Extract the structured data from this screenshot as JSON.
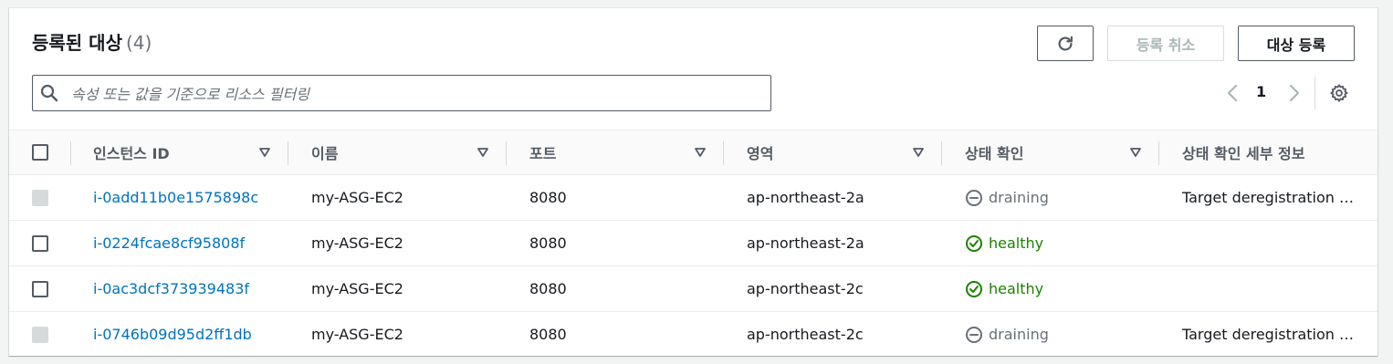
{
  "header": {
    "title": "등록된 대상",
    "count": "(4)",
    "refresh_icon": "refresh-icon",
    "deregister_label": "등록 취소",
    "register_label": "대상 등록"
  },
  "search": {
    "placeholder": "속성 또는 값을 기준으로 리소스 필터링",
    "icon": "search-icon"
  },
  "pagination": {
    "current_page": "1",
    "prev_icon": "chevron-left-icon",
    "next_icon": "chevron-right-icon",
    "settings_icon": "gear-icon"
  },
  "table": {
    "columns": [
      "인스턴스 ID",
      "이름",
      "포트",
      "영역",
      "상태 확인",
      "상태 확인 세부 정보"
    ],
    "rows": [
      {
        "instance_id": "i-0add11b0e1575898c",
        "name": "my-ASG-EC2",
        "port": "8080",
        "zone": "ap-northeast-2a",
        "health": "draining",
        "details": "Target deregistration is in progress",
        "checkbox_disabled": true
      },
      {
        "instance_id": "i-0224fcae8cf95808f",
        "name": "my-ASG-EC2",
        "port": "8080",
        "zone": "ap-northeast-2a",
        "health": "healthy",
        "details": "",
        "checkbox_disabled": false
      },
      {
        "instance_id": "i-0ac3dcf373939483f",
        "name": "my-ASG-EC2",
        "port": "8080",
        "zone": "ap-northeast-2c",
        "health": "healthy",
        "details": "",
        "checkbox_disabled": false
      },
      {
        "instance_id": "i-0746b09d95d2ff1db",
        "name": "my-ASG-EC2",
        "port": "8080",
        "zone": "ap-northeast-2c",
        "health": "draining",
        "details": "Target deregistration is in progress",
        "checkbox_disabled": true
      }
    ]
  },
  "colors": {
    "link": "#0073bb",
    "healthy": "#1d8102",
    "draining": "#687078",
    "border": "#545b64"
  }
}
